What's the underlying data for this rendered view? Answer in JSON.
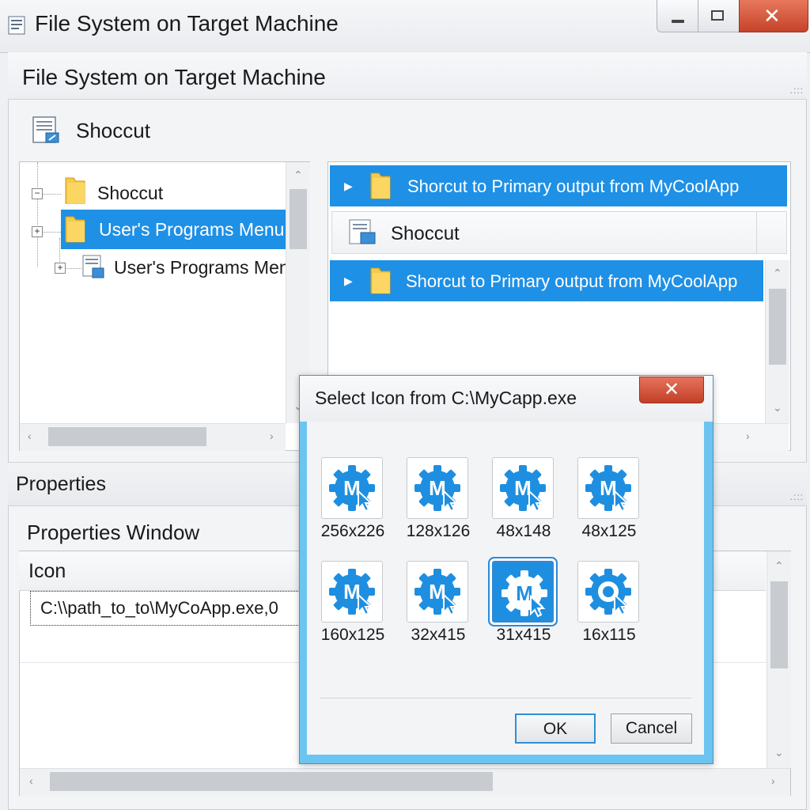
{
  "window": {
    "title": "File System on Target Machine",
    "colors": {
      "selection": "#1e90e6",
      "dialog_frame": "#6cc4f0",
      "close": "#c5432a",
      "icon_blue": "#1e8fe0"
    }
  },
  "panel": {
    "title": "File System on Target Machine",
    "shortcut_label": "Shoccut"
  },
  "tree": {
    "items": [
      {
        "label": "Shoccut",
        "icon": "folder-icon",
        "selected": false
      },
      {
        "label": "User's Programs Menu",
        "icon": "folder-icon",
        "selected": true
      },
      {
        "label": "User's Programs Menu",
        "icon": "shortcut-file-icon",
        "selected": false
      }
    ]
  },
  "list": {
    "rows": [
      {
        "label": "Shorcut to Primary output from MyCoolApp",
        "selected": true
      },
      {
        "label": "Shoccut",
        "selected": false
      },
      {
        "label": "Shorcut to Primary output from MyCoolApp",
        "selected": true
      }
    ]
  },
  "properties": {
    "header": "Properties",
    "window_label": "Properties Window",
    "icon_column": "Icon",
    "icon_value": "C:\\\\path_to_to\\MyCoApp.exe,0"
  },
  "dialog": {
    "title": "Select Icon from C:\\MyCapp.exe",
    "close_glyph": "✕",
    "icons": [
      {
        "size": "256x226",
        "selected": false
      },
      {
        "size": "128x126",
        "selected": false
      },
      {
        "size": "48x148",
        "selected": false
      },
      {
        "size": "48x125",
        "selected": false
      },
      {
        "size": "160x125",
        "selected": false
      },
      {
        "size": "32x415",
        "selected": false
      },
      {
        "size": "31x415",
        "selected": true
      },
      {
        "size": "16x115",
        "selected": false
      }
    ],
    "ok_label": "OK",
    "cancel_label": "Cancel"
  }
}
